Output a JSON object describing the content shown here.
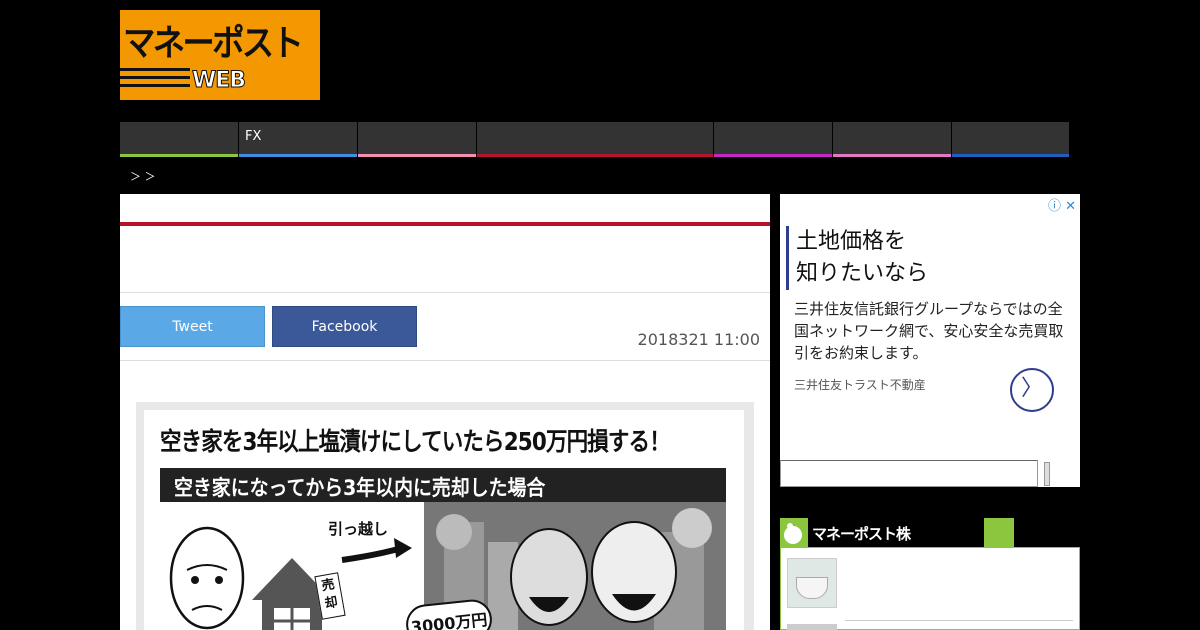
{
  "logo": {
    "text": "マネーポスト",
    "sub": "WEB"
  },
  "nav": {
    "items": [
      {
        "label": "",
        "color": "#8cc63f",
        "width": 119
      },
      {
        "label": "FX",
        "color": "#3f8fe0",
        "width": 119
      },
      {
        "label": "",
        "color": "#f48fb1",
        "width": 119
      },
      {
        "label": "",
        "color": "#b5142c",
        "width": 237
      },
      {
        "label": "",
        "color": "#c428c4",
        "width": 119
      },
      {
        "label": "",
        "color": "#e377c2",
        "width": 119
      },
      {
        "label": "",
        "color": "#1f5fbf",
        "width": 118
      }
    ]
  },
  "breadcrumb": " ＞ ＞",
  "article": {
    "tweet_label": "Tweet",
    "facebook_label": "Facebook",
    "date": "2018321 11:00",
    "figure": {
      "title": "空き家を3年以上塩漬けにしていたら250万円損する！",
      "band": "空き家になってから3年以内に売却した場合",
      "move_label": "引っ越し",
      "sell_label": "売却",
      "amount_label": "3000万円"
    }
  },
  "ad": {
    "title_line1": "土地価格を",
    "title_line2": "知りたいなら",
    "body": "三井住友信託銀行グループならではの全国ネットワーク網で、安心安全な売買取引をお約束します。",
    "sponsor": "三井住友トラスト不動産",
    "info_icon": "ⓘ",
    "close_icon": "✕",
    "arrow_icon": "〉"
  },
  "search": {
    "placeholder": ""
  },
  "widget": {
    "title": "マネーポスト株"
  }
}
